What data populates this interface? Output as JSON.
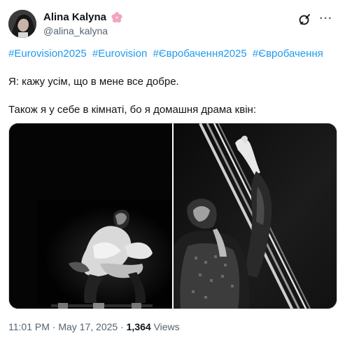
{
  "author": {
    "display_name": "Alina Kalyna",
    "handle": "@alina_kalyna",
    "badge_icon": "cherry-blossom-icon",
    "badge_color": "#f4a6c0"
  },
  "actions": {
    "grok_icon": "grok-icon",
    "more_icon": "more-dots-icon",
    "more_label": "···"
  },
  "tweet": {
    "hashtags": [
      "#Eurovision2025",
      "#Eurovision",
      "#Євробачення2025",
      "#Євробачення"
    ],
    "paragraphs": [
      "Я: кажу усім, що в мене все добре.",
      "Також я у себе в кімнаті, бо я домашня драма квін:"
    ]
  },
  "media": {
    "photos": [
      "black-and-white performer photo",
      "black-and-white performer photo"
    ]
  },
  "meta": {
    "time": "11:01 PM",
    "separator": "·",
    "date": "May 17, 2025",
    "views_count": "1,364",
    "views_label": "Views"
  },
  "colors": {
    "link": "#1d9bf0",
    "text": "#0f1419",
    "secondary": "#536471",
    "border": "#cfd9de"
  }
}
